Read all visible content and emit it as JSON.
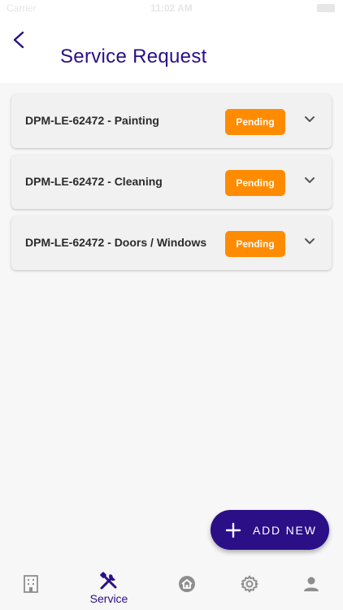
{
  "status_bar": {
    "carrier": "Carrier",
    "time": "11:02 AM"
  },
  "header": {
    "title": "Service Request",
    "back_icon": "chevron-left-icon"
  },
  "requests": [
    {
      "title": "DPM-LE-62472 - Painting",
      "status": "Pending"
    },
    {
      "title": "DPM-LE-62472 - Cleaning",
      "status": "Pending"
    },
    {
      "title": "DPM-LE-62472 - Doors / Windows",
      "status": "Pending"
    }
  ],
  "fab": {
    "label": "ADD NEW",
    "icon": "plus-icon"
  },
  "bottom_nav": {
    "items": [
      {
        "icon": "building-icon",
        "label": ""
      },
      {
        "icon": "tools-icon",
        "label": "Service",
        "active": true
      },
      {
        "icon": "home-icon",
        "label": ""
      },
      {
        "icon": "gear-icon",
        "label": ""
      },
      {
        "icon": "person-icon",
        "label": ""
      }
    ]
  },
  "colors": {
    "primary": "#2a0f87",
    "status_pending": "#ff8c00",
    "inactive_icon": "#8e8e8e"
  }
}
